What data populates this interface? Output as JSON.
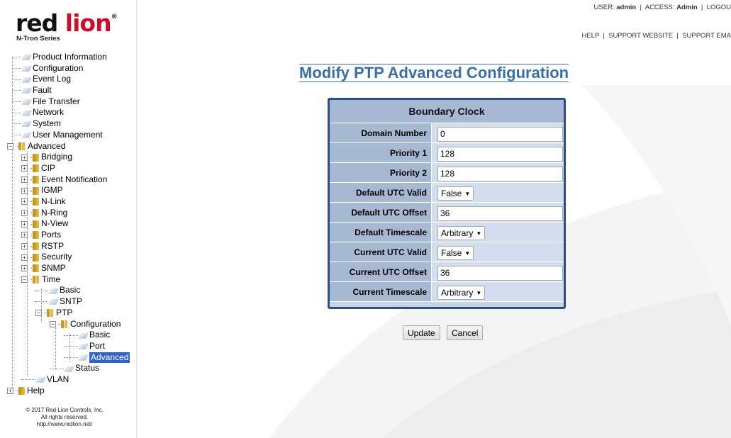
{
  "logo": {
    "brand_red": "red",
    "brand_lion": "lion",
    "sub": "N-Tron Series"
  },
  "header": {
    "user_label": "USER:",
    "user": "admin",
    "access_label": "ACCESS:",
    "access": "Admin",
    "logout": "LOGOU",
    "links": [
      "HELP",
      "SUPPORT WEBSITE",
      "SUPPORT EMA"
    ]
  },
  "nav": {
    "product_information": "Product Information",
    "configuration": "Configuration",
    "event_log": "Event Log",
    "fault": "Fault",
    "file_transfer": "File Transfer",
    "network": "Network",
    "system": "System",
    "user_management": "User Management",
    "advanced": "Advanced",
    "bridging": "Bridging",
    "cip": "CIP",
    "event_notification": "Event Notification",
    "igmp": "IGMP",
    "n_link": "N-Link",
    "n_ring": "N-Ring",
    "n_view": "N-View",
    "ports": "Ports",
    "rstp": "RSTP",
    "security": "Security",
    "snmp": "SNMP",
    "time": "Time",
    "basic": "Basic",
    "sntp": "SNTP",
    "ptp": "PTP",
    "ptp_configuration": "Configuration",
    "ptp_basic": "Basic",
    "ptp_port": "Port",
    "ptp_advanced": "Advanced",
    "status": "Status",
    "vlan": "VLAN",
    "help": "Help"
  },
  "copyright": {
    "line1": "© 2017 Red Lion Controls, Inc.",
    "line2": "All rights reserved.",
    "line3": "http://www.redlion.net/"
  },
  "page": {
    "title": "Modify PTP Advanced Configuration"
  },
  "form": {
    "header": "Boundary Clock",
    "domain_number": {
      "label": "Domain Number",
      "value": "0"
    },
    "priority1": {
      "label": "Priority 1",
      "value": "128"
    },
    "priority2": {
      "label": "Priority 2",
      "value": "128"
    },
    "default_utc_valid": {
      "label": "Default UTC Valid",
      "value": "False"
    },
    "default_utc_offset": {
      "label": "Default UTC Offset",
      "value": "36"
    },
    "default_timescale": {
      "label": "Default Timescale",
      "value": "Arbitrary"
    },
    "current_utc_valid": {
      "label": "Current UTC Valid",
      "value": "False"
    },
    "current_utc_offset": {
      "label": "Current UTC Offset",
      "value": "36"
    },
    "current_timescale": {
      "label": "Current Timescale",
      "value": "Arbitrary"
    }
  },
  "buttons": {
    "update": "Update",
    "cancel": "Cancel"
  },
  "colors": {
    "title": "#3a6fa6",
    "table_border": "#2a4f7e",
    "brand_red": "#c8102e",
    "selected": "#3163c6"
  }
}
